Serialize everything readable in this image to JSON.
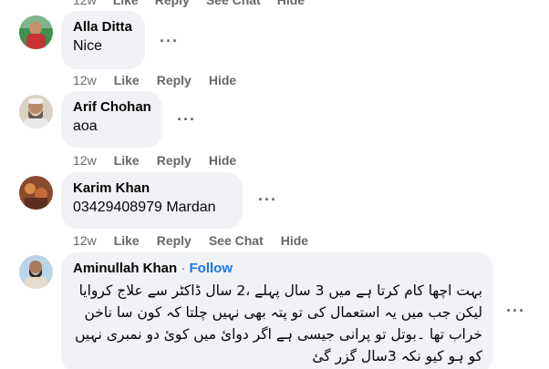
{
  "top_actions": {
    "time": "12w",
    "like": "Like",
    "reply": "Reply",
    "see_chat": "See Chat",
    "hide": "Hide"
  },
  "comments": [
    {
      "author": "Alla Ditta",
      "text": "Nice",
      "more": "···",
      "actions": {
        "time": "12w",
        "like": "Like",
        "reply": "Reply",
        "hide": "Hide"
      }
    },
    {
      "author": "Arif Chohan",
      "text": "aoa",
      "more": "···",
      "actions": {
        "time": "12w",
        "like": "Like",
        "reply": "Reply",
        "hide": "Hide"
      }
    },
    {
      "author": "Karim Khan",
      "text": "03429408979 Mardan",
      "more": "···",
      "actions": {
        "time": "12w",
        "like": "Like",
        "reply": "Reply",
        "see_chat": "See Chat",
        "hide": "Hide"
      }
    },
    {
      "author": "Aminullah Khan",
      "separator": "·",
      "follow": "Follow",
      "text": "بہت اچھا کام کرتا ہے میں 3 سال پہلے ،2 سال ڈاکٹر سے علاج کروایا لیکن جب میں یہ استعمال کی تو پتہ بھی نہیں چلتا کہ کون سا ناخن خراب تھا ۔بوتل تو پرانی جیسی ہے اگر دوائ میں کوئ دو نمبری نہیں کو ہو کیو نکہ 3سال گزر گئ",
      "more": "···"
    }
  ],
  "colors": {
    "bubble": "#f0f2f5",
    "meta": "#65676b",
    "link": "#1877f2",
    "text": "#050505"
  }
}
